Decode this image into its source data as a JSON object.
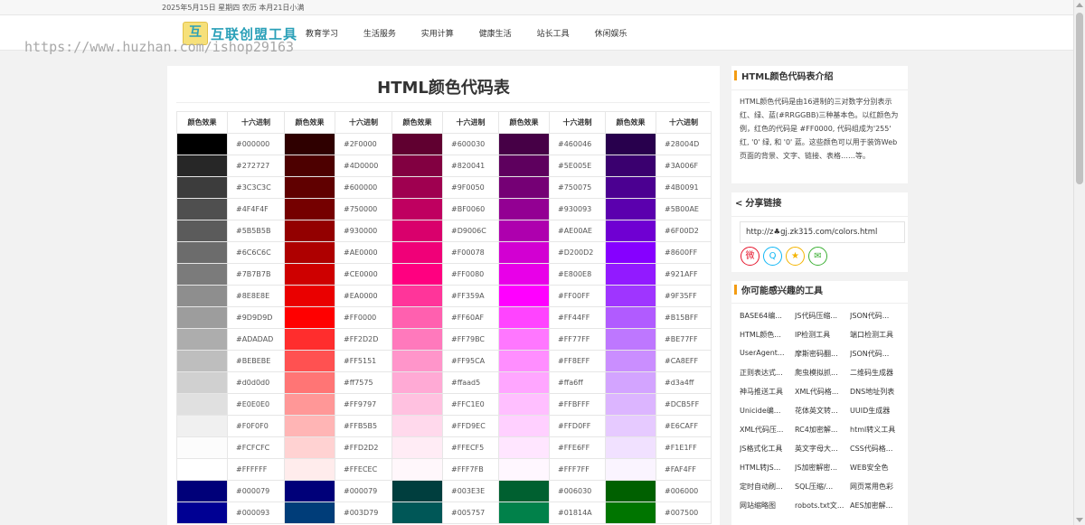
{
  "topbar": {
    "date_text": "2025年5月15日 星期四 农历 本月21日小满"
  },
  "header": {
    "logo_mark": "互",
    "logo_text": "互联创盟工具",
    "nav": [
      "教育学习",
      "生活服务",
      "实用计算",
      "健康生活",
      "站长工具",
      "休闲娱乐"
    ]
  },
  "watermark": "https://www.huzhan.com/ishop29163",
  "main": {
    "title": "HTML颜色代码表",
    "columns": [
      "颜色效果",
      "十六进制",
      "颜色效果",
      "十六进制",
      "颜色效果",
      "十六进制",
      "颜色效果",
      "十六进制",
      "颜色效果",
      "十六进制"
    ],
    "rows": [
      [
        "#000000",
        "#2F0000",
        "#600030",
        "#460046",
        "#28004D"
      ],
      [
        "#272727",
        "#4D0000",
        "#820041",
        "#5E005E",
        "#3A006F"
      ],
      [
        "#3C3C3C",
        "#600000",
        "#9F0050",
        "#750075",
        "#4B0091"
      ],
      [
        "#4F4F4F",
        "#750000",
        "#BF0060",
        "#930093",
        "#5B00AE"
      ],
      [
        "#5B5B5B",
        "#930000",
        "#D9006C",
        "#AE00AE",
        "#6F00D2"
      ],
      [
        "#6C6C6C",
        "#AE0000",
        "#F00078",
        "#D200D2",
        "#8600FF"
      ],
      [
        "#7B7B7B",
        "#CE0000",
        "#FF0080",
        "#E800E8",
        "#921AFF"
      ],
      [
        "#8E8E8E",
        "#EA0000",
        "#FF359A",
        "#FF00FF",
        "#9F35FF"
      ],
      [
        "#9D9D9D",
        "#FF0000",
        "#FF60AF",
        "#FF44FF",
        "#B15BFF"
      ],
      [
        "#ADADAD",
        "#FF2D2D",
        "#FF79BC",
        "#FF77FF",
        "#BE77FF"
      ],
      [
        "#BEBEBE",
        "#FF5151",
        "#FF95CA",
        "#FF8EFF",
        "#CA8EFF"
      ],
      [
        "#d0d0d0",
        "#ff7575",
        "#ffaad5",
        "#ffa6ff",
        "#d3a4ff"
      ],
      [
        "#E0E0E0",
        "#FF9797",
        "#FFC1E0",
        "#FFBFFF",
        "#DCB5FF"
      ],
      [
        "#F0F0F0",
        "#FFB5B5",
        "#FFD9EC",
        "#FFD0FF",
        "#E6CAFF"
      ],
      [
        "#FCFCFC",
        "#FFD2D2",
        "#FFECF5",
        "#FFE6FF",
        "#F1E1FF"
      ],
      [
        "#FFFFFF",
        "#FFECEC",
        "#FFF7FB",
        "#FFF7FF",
        "#FAF4FF"
      ],
      [
        "#000079",
        "#000079",
        "#003E3E",
        "#006030",
        "#006000"
      ],
      [
        "#000093",
        "#003D79",
        "#005757",
        "#01814A",
        "#007500"
      ]
    ]
  },
  "intro": {
    "title": "HTML颜色代码表介绍",
    "text": "HTML颜色代码是由16进制的三对数字分别表示红、绿、蓝(#RRGGBB)三种基本色。以红颜色为例，红色的代码是 #FF0000, 代码组成为'255' 红, '0' 绿, 和 '0' 蓝。这些颜色可以用于装饰Web页面的背景、文字、链接、表格……等。"
  },
  "share": {
    "icon": "share-icon",
    "title": "分享链接",
    "url": "http://z♣gj.zk315.com/colors.html",
    "services": [
      {
        "name": "weibo-icon",
        "glyph": "微",
        "color": "#e6162d"
      },
      {
        "name": "qq-icon",
        "glyph": "Q",
        "color": "#12b7f5"
      },
      {
        "name": "qzone-icon",
        "glyph": "★",
        "color": "#f4b400"
      },
      {
        "name": "wechat-icon",
        "glyph": "✉",
        "color": "#3cb034"
      }
    ]
  },
  "tools": {
    "title": "你可能感兴趣的工具",
    "items": [
      "BASE64编...",
      "JS代码压缩...",
      "JSON代码...",
      "HTML颜色...",
      "IP检测工具",
      "端口检测工具",
      "UserAgent...",
      "摩斯密码翻...",
      "JSON代码...",
      "正则表达式...",
      "爬虫模拟抓...",
      "二维码生成器",
      "神马推送工具",
      "XML代码格...",
      "DNS地址列表",
      "Unicide编...",
      "花体英文转...",
      "UUID生成器",
      "XML代码压...",
      "RC4加密解...",
      "html转义工具",
      "JS格式化工具",
      "英文字母大...",
      "CSS代码格...",
      "HTML转JS...",
      "JS加密解密...",
      "WEB安全色",
      "定时自动刷...",
      "SQL压缩/...",
      "网页常用色彩",
      "网站缩略图",
      "robots.txt文...",
      "AES加密解..."
    ]
  }
}
